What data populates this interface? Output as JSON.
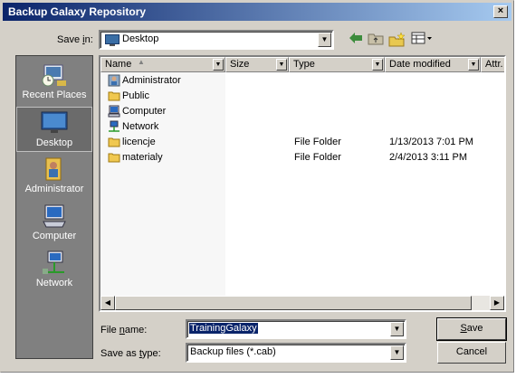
{
  "window": {
    "title": "Backup Galaxy Repository",
    "close_glyph": "×"
  },
  "savein": {
    "label_pre": "Save ",
    "label_u": "i",
    "label_post": "n:",
    "value": "Desktop"
  },
  "toolbar": {
    "back_icon": "back-arrow-icon",
    "up_icon": "up-folder-icon",
    "newfolder_icon": "new-folder-icon",
    "views_icon": "views-menu-icon"
  },
  "places": [
    {
      "label": "Recent Places",
      "icon": "recent-places-icon"
    },
    {
      "label": "Desktop",
      "icon": "desktop-icon",
      "selected": true
    },
    {
      "label": "Administrator",
      "icon": "user-folder-icon"
    },
    {
      "label": "Computer",
      "icon": "computer-icon"
    },
    {
      "label": "Network",
      "icon": "network-icon"
    }
  ],
  "columns": [
    "Name",
    "Size",
    "Type",
    "Date modified",
    "Attr."
  ],
  "rows": [
    {
      "name": "Administrator",
      "type": "",
      "date": "",
      "icon": "user-icon"
    },
    {
      "name": "Public",
      "type": "",
      "date": "",
      "icon": "folder-icon"
    },
    {
      "name": "Computer",
      "type": "",
      "date": "",
      "icon": "computer-icon"
    },
    {
      "name": "Network",
      "type": "",
      "date": "",
      "icon": "network-icon"
    },
    {
      "name": "licencje",
      "type": "File Folder",
      "date": "1/13/2013 7:01 PM",
      "icon": "folder-icon"
    },
    {
      "name": "materialy",
      "type": "File Folder",
      "date": "2/4/2013 3:11 PM",
      "icon": "folder-icon"
    }
  ],
  "filename": {
    "label_pre": "File ",
    "label_u": "n",
    "label_post": "ame:",
    "value": "TrainingGalaxy"
  },
  "filetype": {
    "label_pre": "Save as ",
    "label_u": "t",
    "label_post": "ype:",
    "value": "Backup files (*.cab)"
  },
  "buttons": {
    "save_u": "S",
    "save_rest": "ave",
    "cancel": "Cancel"
  },
  "colors": {
    "title_start": "#0a246a",
    "title_end": "#a6caf0",
    "places_bg": "#808080"
  }
}
